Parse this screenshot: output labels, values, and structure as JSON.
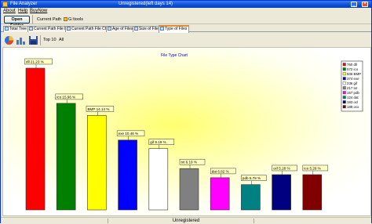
{
  "window": {
    "title": "File Analyzer",
    "title_suffix": "Unregistered(left days 14)"
  },
  "menu": [
    "About",
    "Help",
    "BuyNow"
  ],
  "toolbar": {
    "open_folder": "Open Folder",
    "current_path": "Current Path",
    "path_value": "G:\\tools"
  },
  "tabs": [
    {
      "label": "Total Tree",
      "active": false
    },
    {
      "label": "Current Path File List",
      "active": false
    },
    {
      "label": "Current Path File Chart",
      "active": false
    },
    {
      "label": "Age of Files",
      "active": false
    },
    {
      "label": "Size of Files",
      "active": false
    },
    {
      "label": "Type of Files",
      "active": true
    }
  ],
  "toolbar2": {
    "top10": "Top 10",
    "all": "All",
    "icons": [
      "pie-chart-icon",
      "bar-chart-icon",
      "save-icon"
    ]
  },
  "chart_data": {
    "type": "bar",
    "title": "File Type Chart",
    "categories": [
      ".dll",
      ".ico",
      ".BMP",
      ".exe",
      ".gif",
      ".txt",
      ".dat",
      ".pdb",
      ".ocl",
      ".ico"
    ],
    "values": [
      21.23,
      15.96,
      14.14,
      10.46,
      9.19,
      6.19,
      4.82,
      3.79,
      5.28,
      5.28
    ],
    "labels": [
      "dll 21.23 %",
      "ico 15.96 %",
      "BMP 14.14 %",
      "exe 10.46 %",
      "gif 9.19 %",
      "txt 6.19 %",
      "dat 6.82 %",
      "pdb 5.79 %",
      "ocl 5.28 %",
      "ico 5.28 %"
    ],
    "colors": [
      "#ff0000",
      "#008000",
      "#ffff00",
      "#0000ff",
      "#ffffff",
      "#808080",
      "#ff00ff",
      "#008080",
      "#000080",
      "#800000"
    ],
    "legend": {
      "placement": "right",
      "entries": [
        "760 dll",
        "572 ico",
        "506 BMP",
        "374 exe",
        "236 gif",
        "217 txt",
        "157 pdb",
        "124 dat",
        "183 ocl",
        "189 ocx"
      ]
    }
  },
  "status": {
    "text": "Unregistered"
  }
}
